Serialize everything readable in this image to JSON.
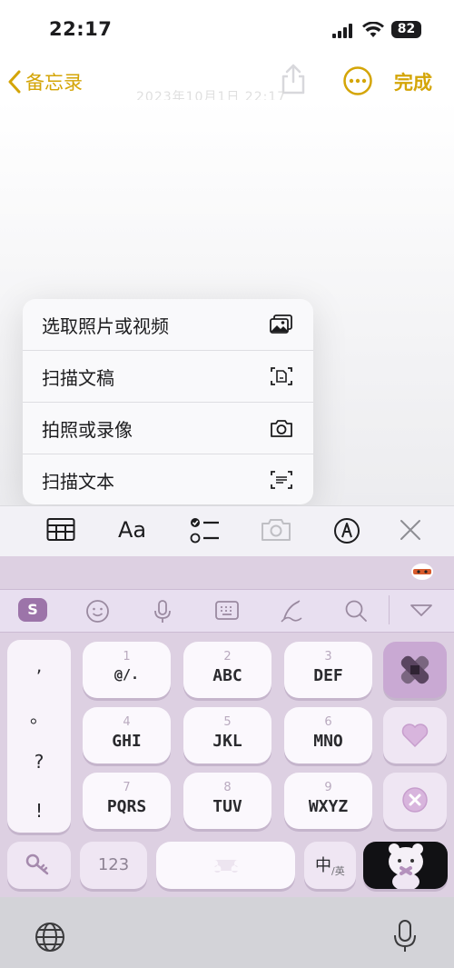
{
  "status": {
    "time": "22:17",
    "battery": "82"
  },
  "nav": {
    "back_label": "备忘录",
    "done_label": "完成",
    "note_date": "2023年10月1日 22:17"
  },
  "menu": {
    "items": [
      {
        "label": "选取照片或视频",
        "icon": "photo-library-icon"
      },
      {
        "label": "扫描文稿",
        "icon": "scan-document-icon"
      },
      {
        "label": "拍照或录像",
        "icon": "camera-icon"
      },
      {
        "label": "扫描文本",
        "icon": "scan-text-icon"
      }
    ]
  },
  "toolbar": {
    "text_format_label": "Aa"
  },
  "keyboard": {
    "punct": [
      ",",
      "。",
      "?",
      "!"
    ],
    "keys": [
      {
        "num": "1",
        "let": "@/."
      },
      {
        "num": "2",
        "let": "ABC"
      },
      {
        "num": "3",
        "let": "DEF"
      },
      {
        "num": "4",
        "let": "GHI"
      },
      {
        "num": "5",
        "let": "JKL"
      },
      {
        "num": "6",
        "let": "MNO"
      },
      {
        "num": "7",
        "let": "PQRS"
      },
      {
        "num": "8",
        "let": "TUV"
      },
      {
        "num": "9",
        "let": "WXYZ"
      }
    ],
    "num_key_label": "123",
    "lang_key_main": "中",
    "lang_key_sub": "/英",
    "suggest_logo": "S",
    "accent_color": "#d4a507",
    "key_color": "#fbf8fd",
    "keyboard_bg": "#ddd0e2"
  }
}
